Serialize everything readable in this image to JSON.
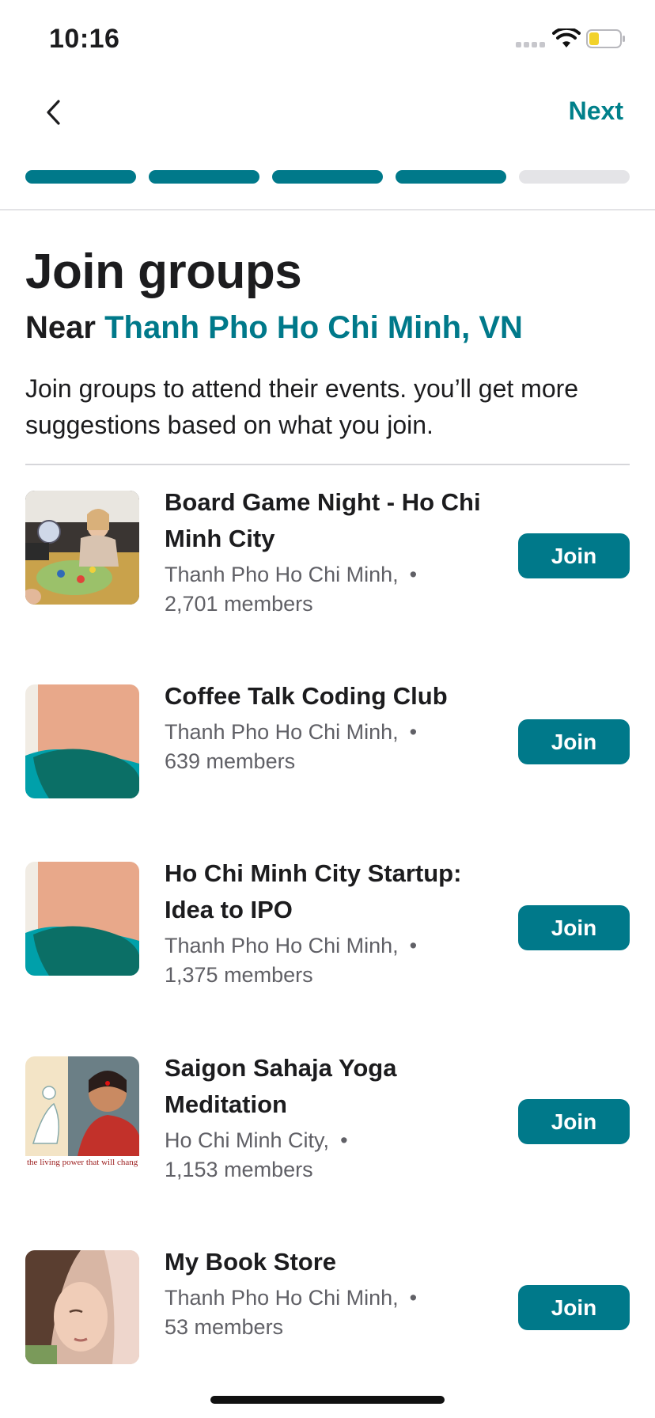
{
  "status_bar": {
    "time": "10:16"
  },
  "nav": {
    "next_label": "Next"
  },
  "progress": {
    "steps_total": 5,
    "steps_completed": 4
  },
  "header": {
    "title": "Join groups",
    "near_prefix": "Near",
    "location": "Thanh Pho Ho Chi Minh, VN",
    "description": "Join groups to attend their events. you’ll get more suggestions based on what you join."
  },
  "groups": [
    {
      "name": "Board Game Night - Ho Chi Minh City",
      "location": "Thanh Pho Ho Chi Minh,",
      "separator": "•",
      "members": "2,701 members",
      "join_label": "Join",
      "thumb": "board-game-photo"
    },
    {
      "name": "Coffee Talk Coding Club",
      "location": "Thanh Pho Ho Chi Minh,",
      "separator": "•",
      "members": "639 members",
      "join_label": "Join",
      "thumb": "placeholder-illustration"
    },
    {
      "name": "Ho Chi Minh City Startup: Idea to IPO",
      "location": "Thanh Pho Ho Chi Minh,",
      "separator": "•",
      "members": "1,375 members",
      "join_label": "Join",
      "thumb": "placeholder-illustration"
    },
    {
      "name": "Saigon Sahaja Yoga Meditation",
      "location": "Ho Chi Minh City,",
      "separator": "•",
      "members": "1,153 members",
      "join_label": "Join",
      "thumb": "yoga-photo",
      "thumb_caption": "the living power that will chang"
    },
    {
      "name": "My Book Store",
      "location": "Thanh Pho Ho Chi Minh,",
      "separator": "•",
      "members": "53 members",
      "join_label": "Join",
      "thumb": "portrait-photo"
    }
  ],
  "colors": {
    "accent": "#00798a",
    "text": "#1c1c1e",
    "muted": "#606066",
    "progress_track": "#e4e4e7"
  }
}
